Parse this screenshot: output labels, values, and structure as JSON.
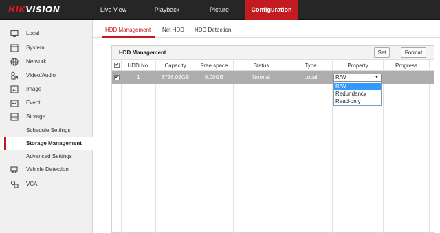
{
  "header": {
    "logo_text": "HIKVISION",
    "logo_prefix": "HIK",
    "logo_suffix": "VISION",
    "nav": [
      "Live View",
      "Playback",
      "Picture",
      "Configuration"
    ],
    "active_nav": "Configuration"
  },
  "sidebar": {
    "items": [
      {
        "label": "Local",
        "icon": "monitor-icon"
      },
      {
        "label": "System",
        "icon": "system-icon"
      },
      {
        "label": "Network",
        "icon": "globe-icon"
      },
      {
        "label": "Video/Audio",
        "icon": "video-audio-icon"
      },
      {
        "label": "Image",
        "icon": "image-icon"
      },
      {
        "label": "Event",
        "icon": "calendar-icon"
      },
      {
        "label": "Storage",
        "icon": "storage-icon"
      }
    ],
    "storage_sub": [
      {
        "label": "Schedule Settings"
      },
      {
        "label": "Storage Management",
        "active": true
      },
      {
        "label": "Advanced Settings"
      }
    ],
    "extra": [
      {
        "label": "Vehicle Detection",
        "icon": "vehicle-detection-icon"
      },
      {
        "label": "VCA",
        "icon": "vca-icon"
      }
    ]
  },
  "tabs": [
    "HDD Management",
    "Net HDD",
    "HDD Detection"
  ],
  "active_tab": "HDD Management",
  "panel": {
    "title": "HDD Management",
    "set_label": "Set",
    "format_label": "Format",
    "columns": [
      "HDD No.",
      "Capacity",
      "Free space",
      "Status",
      "Type",
      "Property",
      "Progress"
    ],
    "rows": [
      {
        "hdd_no": "1",
        "capacity": "3726.02GB",
        "free_space": "0.00GB",
        "status": "Normal",
        "type": "Local",
        "property": "R/W",
        "progress": ""
      }
    ],
    "property_select": {
      "value": "R/W",
      "arrow": "▼",
      "options": [
        "R/W",
        "Redundancy",
        "Read-only"
      ],
      "highlighted": "R/W"
    }
  },
  "colors": {
    "accent": "#c21b20",
    "topbar": "#262626",
    "row_selected": "#adadad",
    "option_highlight": "#3399ff"
  }
}
